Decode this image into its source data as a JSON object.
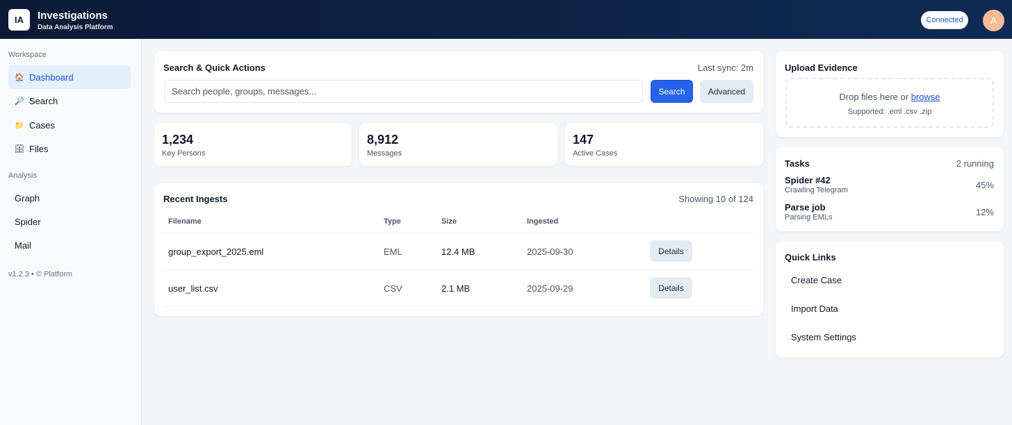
{
  "header": {
    "logo_text": "IA",
    "title": "Investigations",
    "subtitle": "Data Analysis Platform",
    "status_badge": "Connected",
    "avatar_initial": "A"
  },
  "sidebar": {
    "sections": [
      {
        "label": "Workspace",
        "items": [
          {
            "label": "Dashboard",
            "icon": "house-icon",
            "glyph": "🏠",
            "active": true
          },
          {
            "label": "Search",
            "icon": "magnifier-icon",
            "glyph": "🔎",
            "active": false
          },
          {
            "label": "Cases",
            "icon": "folder-icon",
            "glyph": "📁",
            "active": false
          },
          {
            "label": "Files",
            "icon": "file-cabinet-icon",
            "glyph": "🗄",
            "active": false
          }
        ]
      },
      {
        "label": "Analysis",
        "items": [
          {
            "label": "Graph",
            "active": false
          },
          {
            "label": "Spider",
            "active": false
          },
          {
            "label": "Mail",
            "active": false
          }
        ]
      }
    ],
    "footer": "v1.2.3 • © Platform"
  },
  "search_card": {
    "title": "Search & Quick Actions",
    "sync_status": "Last sync: 2m",
    "placeholder": "Search people, groups, messages...",
    "search_button": "Search",
    "advanced_button": "Advanced"
  },
  "stats": [
    {
      "value": "1,234",
      "label": "Key Persons"
    },
    {
      "value": "8,912",
      "label": "Messages"
    },
    {
      "value": "147",
      "label": "Active Cases"
    }
  ],
  "ingests": {
    "title": "Recent Ingests",
    "count_text": "Showing 10 of 124",
    "columns": [
      "Filename",
      "Type",
      "Size",
      "Ingested"
    ],
    "rows": [
      {
        "filename": "group_export_2025.eml",
        "type": "EML",
        "size": "12.4 MB",
        "date": "2025-09-30",
        "action": "Details"
      },
      {
        "filename": "user_list.csv",
        "type": "CSV",
        "size": "2.1 MB",
        "date": "2025-09-29",
        "action": "Details"
      }
    ]
  },
  "upload": {
    "title": "Upload Evidence",
    "drop_text": "Drop files here or",
    "browse_link": "browse",
    "supported": "Supported: .eml .csv .zip"
  },
  "tasks": {
    "title": "Tasks",
    "running": "2 running",
    "items": [
      {
        "name": "Spider #42",
        "desc": "Crawling Telegram",
        "progress": "45%"
      },
      {
        "name": "Parse job",
        "desc": "Parsing EMLs",
        "progress": "12%"
      }
    ]
  },
  "quick_links": {
    "title": "Quick Links",
    "items": [
      "Create Case",
      "Import Data",
      "System Settings"
    ]
  },
  "colors": {
    "header_start": "#0a1a35",
    "header_end": "#0f2b55",
    "accent": "#2563eb",
    "active_nav_bg": "#e4efff",
    "avatar": "#f8bb95"
  }
}
